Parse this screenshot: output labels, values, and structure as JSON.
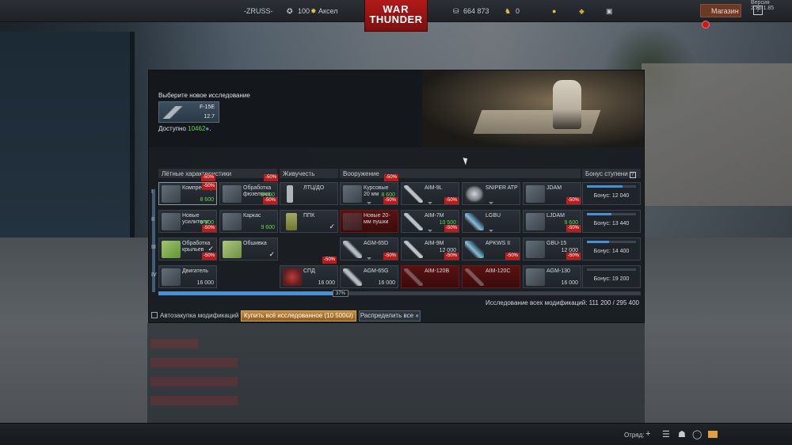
{
  "top": {
    "player": "-ZRUSS-",
    "rank_level": "100",
    "title": "Аксел",
    "silver": "664 873",
    "gold": "0",
    "shop_label": "Магазин",
    "help": "?",
    "version": "Версия 2.55.1.85",
    "logo_line1": "WAR",
    "logo_line2": "THUNDER"
  },
  "research": {
    "title": "Выберите новое исследование",
    "vehicle_name": "F-15E",
    "vehicle_br": "12.7",
    "available_label": "Доступно",
    "available_value": "10462",
    "available_suffix": "."
  },
  "columns": {
    "flight": "Лётные характеристики",
    "survivability": "Живучесть",
    "armament": "Вооружение",
    "bonus": "Бонус ступени"
  },
  "tiers": [
    "I",
    "II",
    "III",
    "IV"
  ],
  "modules": [
    {
      "id": "compressor",
      "name": "Компрессор",
      "value": "8 600",
      "green": true,
      "badge": "-50%"
    },
    {
      "id": "fuselage",
      "name": "Обработка фюзеляжа",
      "value": "8 600",
      "green": true,
      "badge": "-50%"
    },
    {
      "id": "ltc",
      "name": "ЛТЦ/ДО",
      "value": "",
      "green": false,
      "badge": ""
    },
    {
      "id": "course20",
      "name": "Курсовые 20 мм",
      "value": "8 600",
      "green": true,
      "badge": "-50%"
    },
    {
      "id": "aim9l",
      "name": "AIM-9L",
      "value": "",
      "green": false,
      "badge": "-50%"
    },
    {
      "id": "sniper",
      "name": "SNIPER ATP",
      "value": "",
      "green": false,
      "badge": ""
    },
    {
      "id": "jdam",
      "name": "JDAM",
      "value": "",
      "green": false,
      "badge": "-50%"
    },
    {
      "id": "boosters",
      "name": "Новые усилители",
      "value": "9 600",
      "green": true,
      "badge": "-50%"
    },
    {
      "id": "frame",
      "name": "Каркас",
      "value": "9 600",
      "green": true,
      "badge": ""
    },
    {
      "id": "ppk",
      "name": "ППК",
      "value": "",
      "green": false,
      "badge": ""
    },
    {
      "id": "new20",
      "name": "Новые 20-мм пушки",
      "value": "",
      "green": false,
      "badge": ""
    },
    {
      "id": "aim7m",
      "name": "AIM-7M",
      "value": "10 500",
      "green": true,
      "badge": "-50%"
    },
    {
      "id": "lgbu",
      "name": "LGBU",
      "value": "",
      "green": false,
      "badge": ""
    },
    {
      "id": "ljdam",
      "name": "LJDAM",
      "value": "9 600",
      "green": true,
      "badge": "-50%"
    },
    {
      "id": "wings",
      "name": "Обработка крыльев",
      "value": "",
      "green": false,
      "badge": "-50%"
    },
    {
      "id": "skin",
      "name": "Обшивка",
      "value": "",
      "green": false,
      "badge": ""
    },
    {
      "id": "agm65d",
      "name": "AGM-65D",
      "value": "",
      "green": false,
      "badge": "-50%"
    },
    {
      "id": "aim9m",
      "name": "AIM-9M",
      "value": "12 000",
      "green": false,
      "badge": "-50%"
    },
    {
      "id": "apkws",
      "name": "APKWS II",
      "value": "",
      "green": false,
      "badge": "-50%"
    },
    {
      "id": "gbu15",
      "name": "GBU-15",
      "value": "12 000",
      "green": false,
      "badge": "-50%"
    },
    {
      "id": "engine",
      "name": "Двигатель",
      "value": "16 000",
      "green": false,
      "badge": ""
    },
    {
      "id": "spd",
      "name": "СПД",
      "value": "16 000",
      "green": false,
      "badge": ""
    },
    {
      "id": "agm65g",
      "name": "AGM-65G",
      "value": "16 000",
      "green": false,
      "badge": ""
    },
    {
      "id": "aim120b",
      "name": "AIM-120B",
      "value": "",
      "green": false,
      "badge": ""
    },
    {
      "id": "aim120c",
      "name": "AIM-120C",
      "value": "",
      "green": false,
      "badge": ""
    },
    {
      "id": "agm130",
      "name": "AGM-130",
      "value": "16 000",
      "green": false,
      "badge": ""
    }
  ],
  "bonus": [
    {
      "text": "Бонус: 12 040",
      "progress": 0.72
    },
    {
      "text": "Бонус: 13 440",
      "progress": 0.5
    },
    {
      "text": "Бонус: 14 400",
      "progress": 0.45
    },
    {
      "text": "Бонус: 19 200",
      "progress": 0.0
    }
  ],
  "progress": {
    "value": 0.37,
    "label": "37%"
  },
  "total": "Исследование всех модификаций: 111 200 / 295 400",
  "footer": {
    "autobuy": "Автозакупка модификаций",
    "buy_all": "Купить всё исследованное (10 500",
    "distribute": "Распределить все"
  },
  "bottom": {
    "squad": "Отряд:"
  },
  "colors": {
    "accent": "#4a90d4",
    "discount": "#b81d1d",
    "green": "#62d54c",
    "shop": "#6b3a26"
  }
}
